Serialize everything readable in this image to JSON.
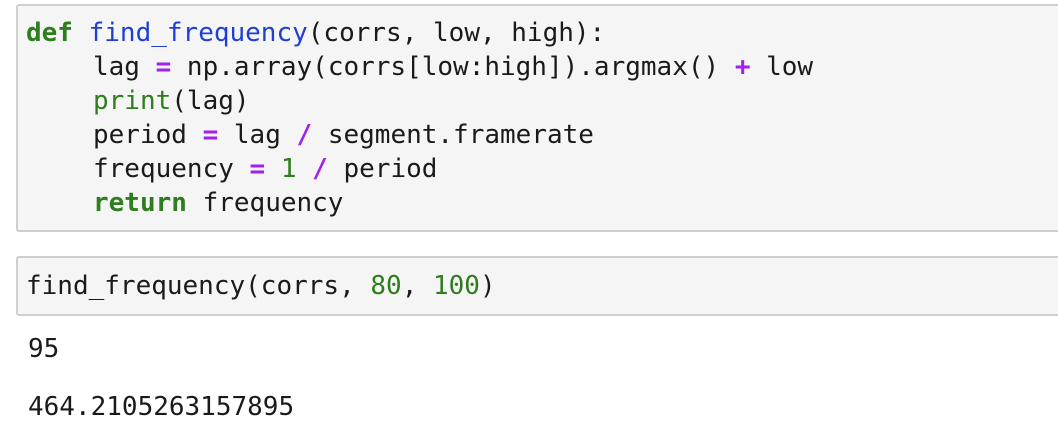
{
  "code_cell_1": {
    "line1": {
      "kw_def": "def",
      "fn_name": "find_frequency",
      "args": "(corrs, low, high):"
    },
    "line2": {
      "lhs": "lag ",
      "eq": "=",
      "mid": " np.array(corrs[low:high]).argmax() ",
      "plus": "+",
      "rhs": " low"
    },
    "line3": {
      "builtin": "print",
      "rest": "(lag)"
    },
    "line4": {
      "lhs": "period ",
      "eq": "=",
      "mid": " lag ",
      "div": "/",
      "rhs": " segment.framerate"
    },
    "line5": {
      "lhs": "frequency ",
      "eq": "=",
      "sp": " ",
      "num": "1",
      "sp2": " ",
      "div": "/",
      "rhs": " period"
    },
    "line6": {
      "kw_return": "return",
      "rest": " frequency"
    }
  },
  "code_cell_2": {
    "call": "find_frequency(corrs, ",
    "arg1": "80",
    "comma": ", ",
    "arg2": "100",
    "close": ")"
  },
  "outputs": {
    "printed": "95",
    "result": "464.2105263157895"
  },
  "colors": {
    "keyword": "#2e7d1f",
    "function_name": "#1f3fd4",
    "operator": "#a020f0",
    "number": "#2e7d1f",
    "cell_background": "#f5f5f5",
    "cell_border": "#cfcfcf"
  }
}
